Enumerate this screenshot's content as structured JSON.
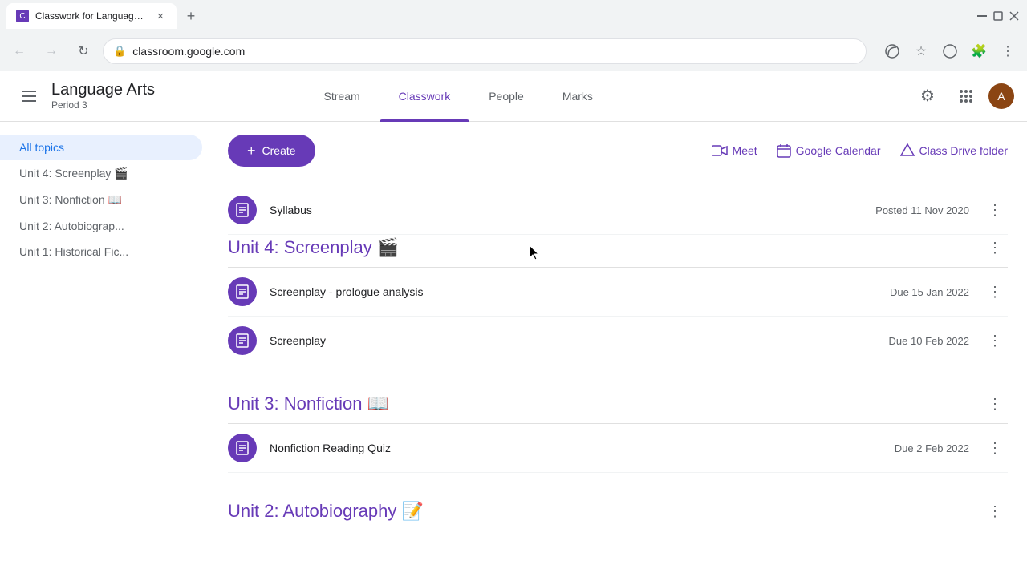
{
  "browser": {
    "tab_title": "Classwork for Language Arts Pe...",
    "tab_favicon": "C",
    "url": "classroom.google.com",
    "new_tab_label": "+"
  },
  "app": {
    "title_main": "Language Arts",
    "title_sub": "Period 3",
    "nav_tabs": [
      {
        "id": "stream",
        "label": "Stream",
        "active": false
      },
      {
        "id": "classwork",
        "label": "Classwork",
        "active": true
      },
      {
        "id": "people",
        "label": "People",
        "active": false
      },
      {
        "id": "marks",
        "label": "Marks",
        "active": false
      }
    ],
    "toolbar": {
      "create_label": "Create",
      "actions": [
        {
          "id": "meet",
          "label": "Meet",
          "icon": "📹"
        },
        {
          "id": "google-calendar",
          "label": "Google Calendar",
          "icon": "📅"
        },
        {
          "id": "class-drive-folder",
          "label": "Class Drive folder",
          "icon": "△"
        }
      ]
    },
    "sidebar": {
      "items": [
        {
          "id": "all-topics",
          "label": "All topics",
          "active": true
        },
        {
          "id": "unit4",
          "label": "Unit 4: Screenplay 🎬",
          "active": false
        },
        {
          "id": "unit3",
          "label": "Unit 3: Nonfiction 📖",
          "active": false
        },
        {
          "id": "unit2",
          "label": "Unit 2: Autobiograp...",
          "active": false
        },
        {
          "id": "unit1",
          "label": "Unit 1: Historical Fic...",
          "active": false
        }
      ]
    },
    "syllabus": {
      "title": "Syllabus",
      "posted": "Posted 11 Nov 2020",
      "icon": "📋"
    },
    "sections": [
      {
        "id": "unit4",
        "title": "Unit 4: Screenplay 🎬",
        "assignments": [
          {
            "id": "screenplay-prologue",
            "name": "Screenplay - prologue analysis",
            "due": "Due 15 Jan 2022"
          },
          {
            "id": "screenplay",
            "name": "Screenplay",
            "due": "Due 10 Feb 2022"
          }
        ]
      },
      {
        "id": "unit3",
        "title": "Unit 3: Nonfiction 📖",
        "assignments": [
          {
            "id": "nonfiction-quiz",
            "name": "Nonfiction Reading Quiz",
            "due": "Due 2 Feb 2022"
          }
        ]
      },
      {
        "id": "unit2",
        "title": "Unit 2: Autobiography 📝",
        "assignments": []
      }
    ]
  }
}
